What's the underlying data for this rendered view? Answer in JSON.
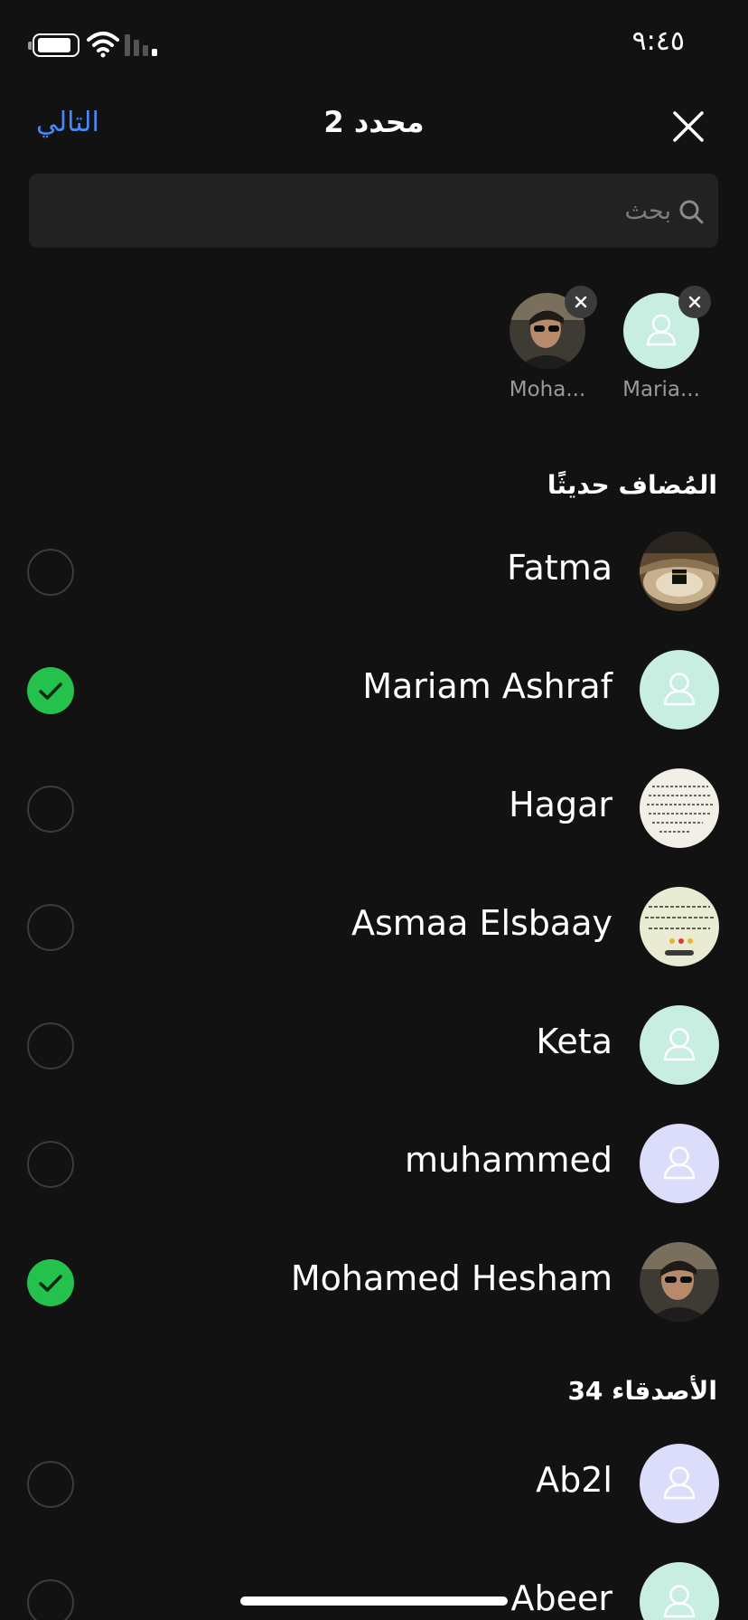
{
  "status_bar": {
    "time": "٩:٤٥"
  },
  "header": {
    "next_label": "التالي",
    "title": "2 محدد"
  },
  "search": {
    "placeholder": "بحث",
    "value": ""
  },
  "selected_chips": [
    {
      "name": "Moha...",
      "avatar": "photo-man-sunglasses"
    },
    {
      "name": "Maria...",
      "avatar": "default-person"
    }
  ],
  "sections": [
    {
      "title": "المُضاف حديثًا",
      "contacts": [
        {
          "name": "Fatma",
          "selected": false,
          "avatar": "photo-kaaba"
        },
        {
          "name": "Mariam Ashraf",
          "selected": true,
          "avatar": "default-person"
        },
        {
          "name": "Hagar",
          "selected": false,
          "avatar": "photo-text"
        },
        {
          "name": "Asmaa Elsbaay",
          "selected": false,
          "avatar": "photo-text"
        },
        {
          "name": "Keta",
          "selected": false,
          "avatar": "default-person"
        },
        {
          "name": "muhammed",
          "selected": false,
          "avatar": "default-person"
        },
        {
          "name": "Mohamed Hesham",
          "selected": true,
          "avatar": "photo-man-sunglasses"
        }
      ]
    },
    {
      "title": "الأصدقاء 34",
      "contacts": [
        {
          "name": "Ab2l",
          "selected": false,
          "avatar": "default-person"
        },
        {
          "name": "Abeer",
          "selected": false,
          "avatar": "default-person"
        }
      ]
    }
  ],
  "colors": {
    "background": "#121212",
    "accent": "#4b86f5",
    "check": "#24c24c"
  }
}
